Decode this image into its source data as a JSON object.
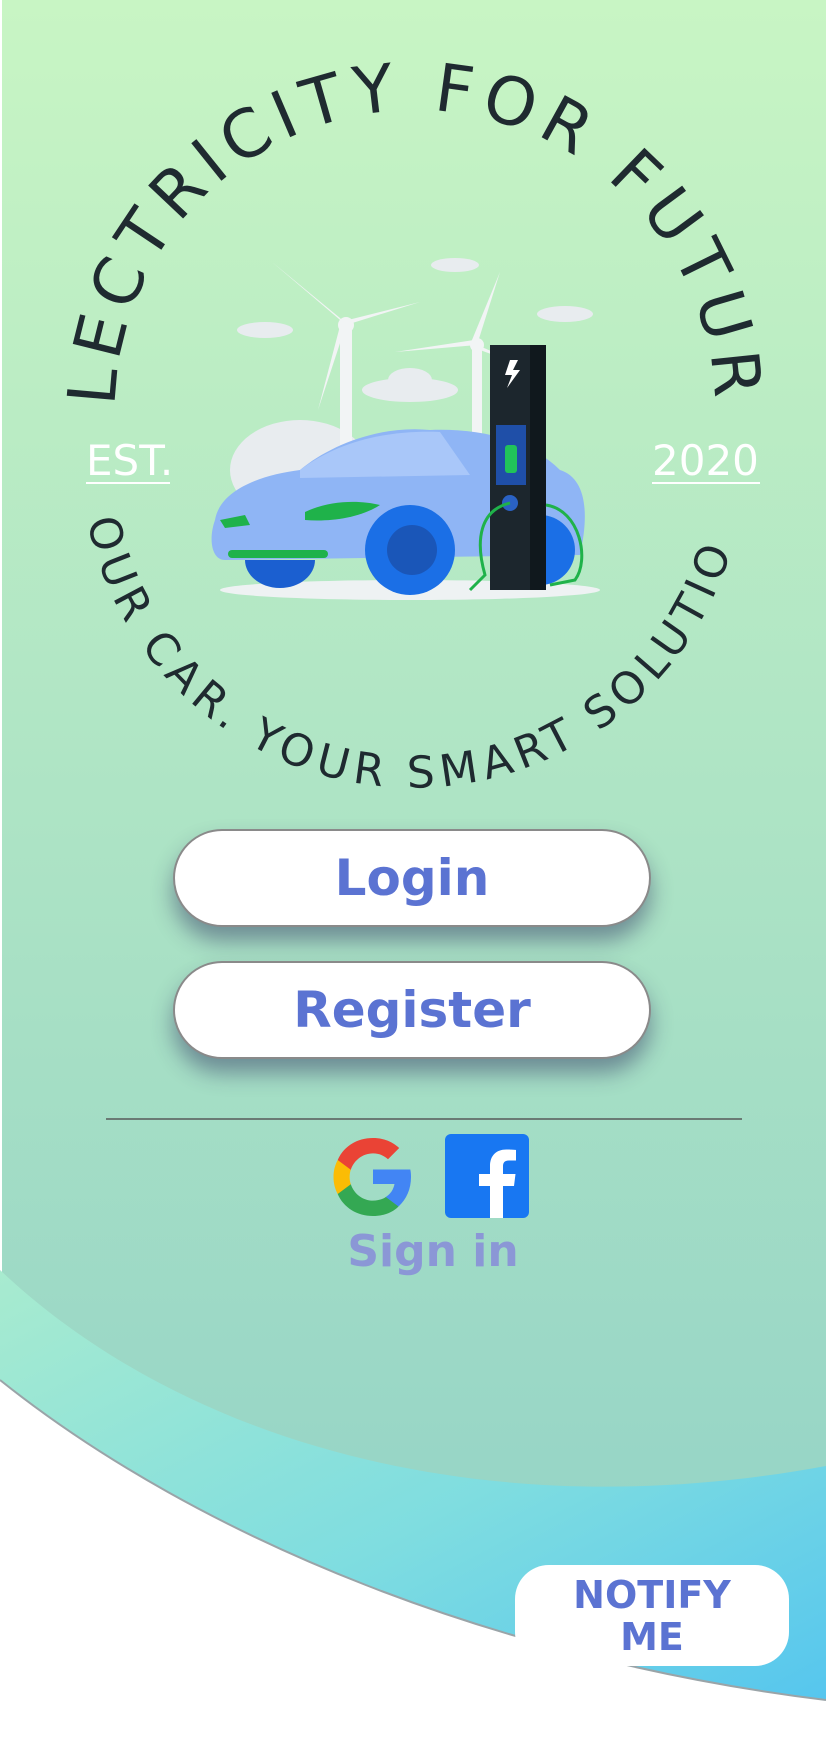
{
  "logo": {
    "title_arc": "ELECTRICITY FOR FUTURE",
    "est_label": "EST.",
    "year_label": "2020",
    "tagline_arc": "YOUR CAR. YOUR SMART SOLUTION."
  },
  "actions": {
    "login_label": "Login",
    "register_label": "Register"
  },
  "social": {
    "signin_label": "Sign in",
    "google_icon": "google-icon",
    "facebook_icon": "facebook-icon"
  },
  "notify": {
    "line1": "NOTIFY",
    "line2": "ME"
  },
  "colors": {
    "accent": "#5b73d2",
    "bg_top": "#c8f5c4",
    "bg_bottom": "#8fd0c6",
    "wave": "#5ec9ea",
    "logo_text": "#1f2a30"
  }
}
